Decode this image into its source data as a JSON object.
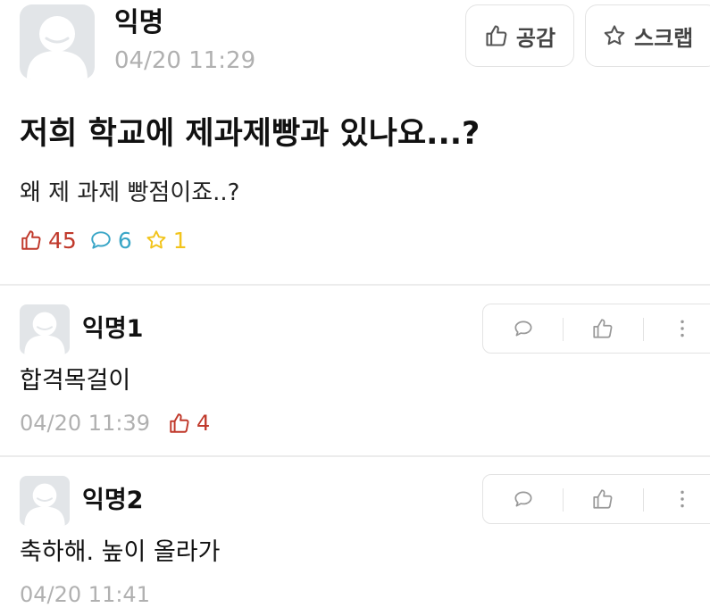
{
  "post": {
    "author": "익명",
    "timestamp": "04/20 11:29",
    "buttons": {
      "like_label": "공감",
      "scrap_label": "스크랩"
    },
    "title": "저희 학교에 제과제빵과 있나요...?",
    "body": "왜 제 과제 빵점이죠..?",
    "stats": {
      "likes": "45",
      "comments": "6",
      "scraps": "1"
    }
  },
  "comments": [
    {
      "author": "익명1",
      "text": "합격목걸이",
      "timestamp": "04/20 11:39",
      "likes": "4"
    },
    {
      "author": "익명2",
      "text": "축하해. 높이 올라가",
      "timestamp": "04/20 11:41",
      "likes": ""
    }
  ],
  "colors": {
    "like": "#c0392b",
    "comment": "#3aa6c7",
    "scrap": "#f2c41b",
    "meta_gray": "#b0b0b0",
    "avatar_bg": "#e2e5e8"
  },
  "icons": [
    "avatar-icon",
    "thumbs-up-icon",
    "star-icon",
    "speech-bubble-icon",
    "more-vertical-icon"
  ]
}
